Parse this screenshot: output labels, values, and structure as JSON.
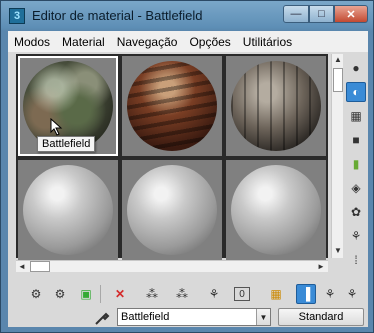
{
  "window": {
    "title": "Editor de material - Battlefield",
    "minimize_glyph": "—",
    "maximize_glyph": "□",
    "close_glyph": "✕"
  },
  "menu": {
    "items": [
      "Modos",
      "Material",
      "Navegação",
      "Opções",
      "Utilitários"
    ]
  },
  "sample_slots": {
    "selected_index": 0,
    "materials": [
      {
        "name": "Battlefield",
        "appearance": "mossy-rock"
      },
      {
        "name": "",
        "appearance": "rusty-metal"
      },
      {
        "name": "",
        "appearance": "wood-planks"
      },
      {
        "name": "",
        "appearance": "default-gray"
      },
      {
        "name": "",
        "appearance": "default-gray"
      },
      {
        "name": "",
        "appearance": "default-gray"
      }
    ]
  },
  "tooltip": {
    "text": "Battlefield"
  },
  "scrollbars": {
    "up": "▲",
    "down": "▼",
    "left": "◄",
    "right": "►"
  },
  "side_toolbar": [
    {
      "icon": "sample-type-sphere-icon",
      "glyph": "●",
      "active": false
    },
    {
      "icon": "backlight-icon",
      "glyph": "◐",
      "active": true
    },
    {
      "icon": "background-checker-icon",
      "glyph": "▦",
      "active": false
    },
    {
      "icon": "sample-uv-tiling-icon",
      "glyph": "■",
      "active": false
    },
    {
      "icon": "video-color-check-icon",
      "glyph": "▮",
      "active": false
    },
    {
      "icon": "make-preview-icon",
      "glyph": "◈",
      "active": false
    },
    {
      "icon": "options-icon",
      "glyph": "✿",
      "active": false
    },
    {
      "icon": "select-by-material-icon",
      "glyph": "⚘",
      "active": false
    },
    {
      "icon": "material-map-navigator-icon",
      "glyph": "⁞",
      "active": false
    }
  ],
  "bottom_toolbar": [
    {
      "icon": "get-material-icon",
      "glyph": "⚙"
    },
    {
      "icon": "put-material-to-scene-icon",
      "glyph": "⚙"
    },
    {
      "icon": "assign-material-to-selection-icon",
      "glyph": "▣"
    },
    {
      "icon": "reset-map-icon",
      "glyph": "✕",
      "color": "#d42a2a"
    },
    {
      "icon": "make-material-copy-icon",
      "glyph": "⁂"
    },
    {
      "icon": "make-unique-icon",
      "glyph": "⁂"
    },
    {
      "icon": "put-to-library-icon",
      "glyph": "⚘"
    },
    {
      "icon": "material-id-channel-icon",
      "glyph": "0"
    },
    {
      "icon": "show-shaded-material-icon",
      "glyph": "▦"
    },
    {
      "icon": "show-end-result-icon",
      "glyph": "▐",
      "active": true
    },
    {
      "icon": "go-to-parent-icon",
      "glyph": "⚘"
    },
    {
      "icon": "go-forward-to-sibling-icon",
      "glyph": "⚘"
    }
  ],
  "material_name": {
    "value": "Battlefield",
    "dropdown_glyph": "▼"
  },
  "material_type_button": {
    "label": "Standard"
  },
  "colors": {
    "accent": "#3a8bd6",
    "slot_background": "#808080",
    "close_button": "#c24a32"
  }
}
